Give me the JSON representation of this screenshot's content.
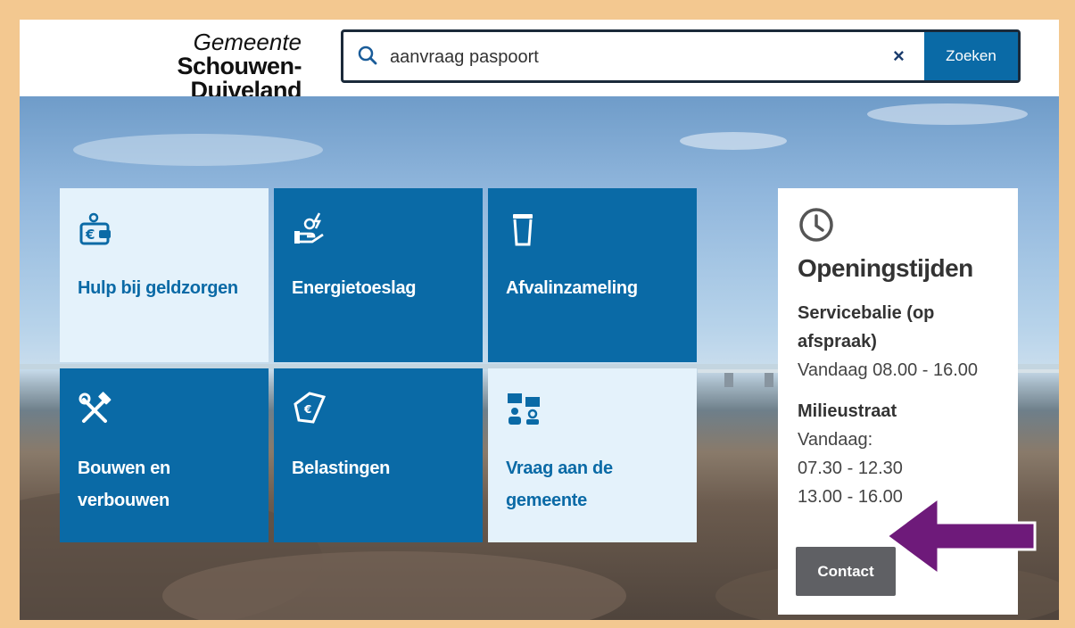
{
  "logo": {
    "line1": "Gemeente",
    "line2": "Schouwen-Duiveland"
  },
  "search": {
    "value": "aanvraag paspoort",
    "clear": "×",
    "button": "Zoeken"
  },
  "tiles": [
    {
      "label": "Hulp bij geldzorgen",
      "icon": "wallet-euro-icon",
      "style": "light"
    },
    {
      "label": "Energietoeslag",
      "icon": "hand-energy-icon",
      "style": "dark"
    },
    {
      "label": "Afvalinzameling",
      "icon": "trash-bin-icon",
      "style": "dark"
    },
    {
      "label": "Bouwen en verbouwen",
      "icon": "hammer-wrench-icon",
      "style": "dark"
    },
    {
      "label": "Belastingen",
      "icon": "tax-document-icon",
      "style": "dark"
    },
    {
      "label": "Vraag aan de gemeente",
      "icon": "chat-people-icon",
      "style": "light"
    }
  ],
  "hours": {
    "title": "Openingstijden",
    "service_label": "Servicebalie (op afspraak)",
    "service_time": "Vandaag 08.00 - 16.00",
    "milieu_label": "Milieustraat",
    "milieu_day": "Vandaag:",
    "milieu_time1": "07.30 - 12.30",
    "milieu_time2": "13.00 - 16.00",
    "contact": "Contact"
  },
  "colors": {
    "border": "#f3c890",
    "primary": "#0a6aa6",
    "light_tile": "#e4f2fb",
    "arrow": "#6e1a7a",
    "contact_btn": "#5f6064"
  }
}
